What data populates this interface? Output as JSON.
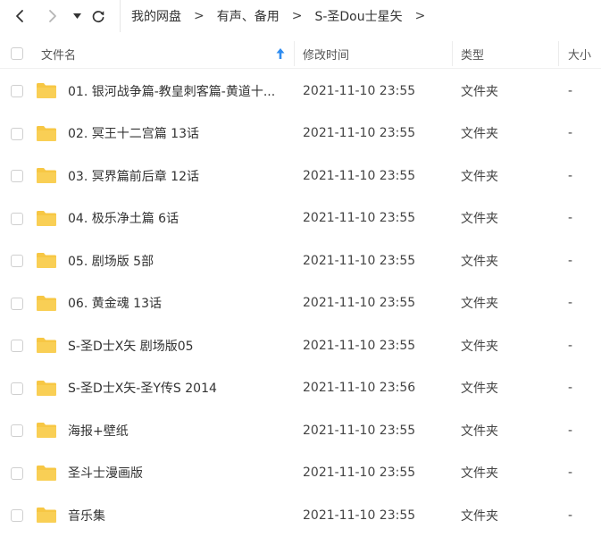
{
  "nav": {
    "back_icon": "chevron-left-icon",
    "forward_icon": "chevron-right-icon",
    "history_icon": "caret-down-icon",
    "refresh_icon": "refresh-icon"
  },
  "breadcrumb": {
    "items": [
      "我的网盘",
      "有声、备用",
      "S-圣Dou士星矢"
    ],
    "separator": ">"
  },
  "table": {
    "headers": {
      "name": "文件名",
      "modified": "修改时间",
      "type": "类型",
      "size": "大小"
    },
    "rows": [
      {
        "name": "01. 银河战争篇-教皇刺客篇-黄道十...",
        "modified": "2021-11-10 23:55",
        "type": "文件夹",
        "size": "-"
      },
      {
        "name": "02. 冥王十二宫篇 13话",
        "modified": "2021-11-10 23:55",
        "type": "文件夹",
        "size": "-"
      },
      {
        "name": "03. 冥界篇前后章 12话",
        "modified": "2021-11-10 23:55",
        "type": "文件夹",
        "size": "-"
      },
      {
        "name": "04. 极乐净土篇 6话",
        "modified": "2021-11-10 23:55",
        "type": "文件夹",
        "size": "-"
      },
      {
        "name": "05. 剧场版 5部",
        "modified": "2021-11-10 23:55",
        "type": "文件夹",
        "size": "-"
      },
      {
        "name": "06. 黄金魂 13话",
        "modified": "2021-11-10 23:55",
        "type": "文件夹",
        "size": "-"
      },
      {
        "name": "S-圣D士X矢 剧场版05",
        "modified": "2021-11-10 23:55",
        "type": "文件夹",
        "size": "-"
      },
      {
        "name": "S-圣D士X矢-圣Y传S 2014",
        "modified": "2021-11-10 23:56",
        "type": "文件夹",
        "size": "-"
      },
      {
        "name": "海报+壁纸",
        "modified": "2021-11-10 23:55",
        "type": "文件夹",
        "size": "-"
      },
      {
        "name": "圣斗士漫画版",
        "modified": "2021-11-10 23:55",
        "type": "文件夹",
        "size": "-"
      },
      {
        "name": "音乐集",
        "modified": "2021-11-10 23:55",
        "type": "文件夹",
        "size": "-"
      }
    ]
  },
  "colors": {
    "folder": "#F7C744",
    "sort_arrow": "#2E8CF0"
  }
}
